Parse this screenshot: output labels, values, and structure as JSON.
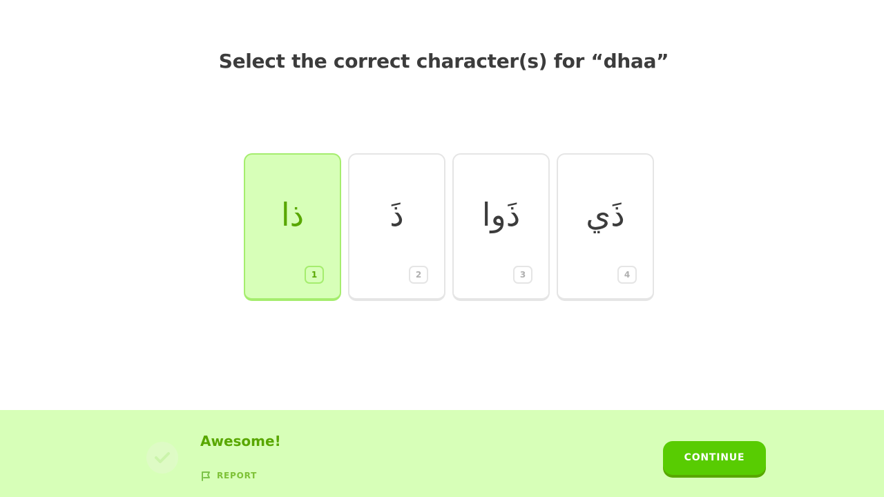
{
  "question": {
    "prompt": "Select the correct character(s) for “dhaa”"
  },
  "choices": [
    {
      "glyph": "ذا",
      "key": "1",
      "selected": true
    },
    {
      "glyph": "ذَ",
      "key": "2",
      "selected": false
    },
    {
      "glyph": "ذَوا",
      "key": "3",
      "selected": false
    },
    {
      "glyph": "ذَي",
      "key": "4",
      "selected": false
    }
  ],
  "feedback": {
    "message": "Awesome!",
    "report_label": "REPORT",
    "badge_icon": "checkmark-icon"
  },
  "actions": {
    "continue_label": "CONTINUE"
  },
  "colors": {
    "correct_bg": "#d7ffb8",
    "correct_text": "#58a700",
    "button": "#58cc02"
  }
}
